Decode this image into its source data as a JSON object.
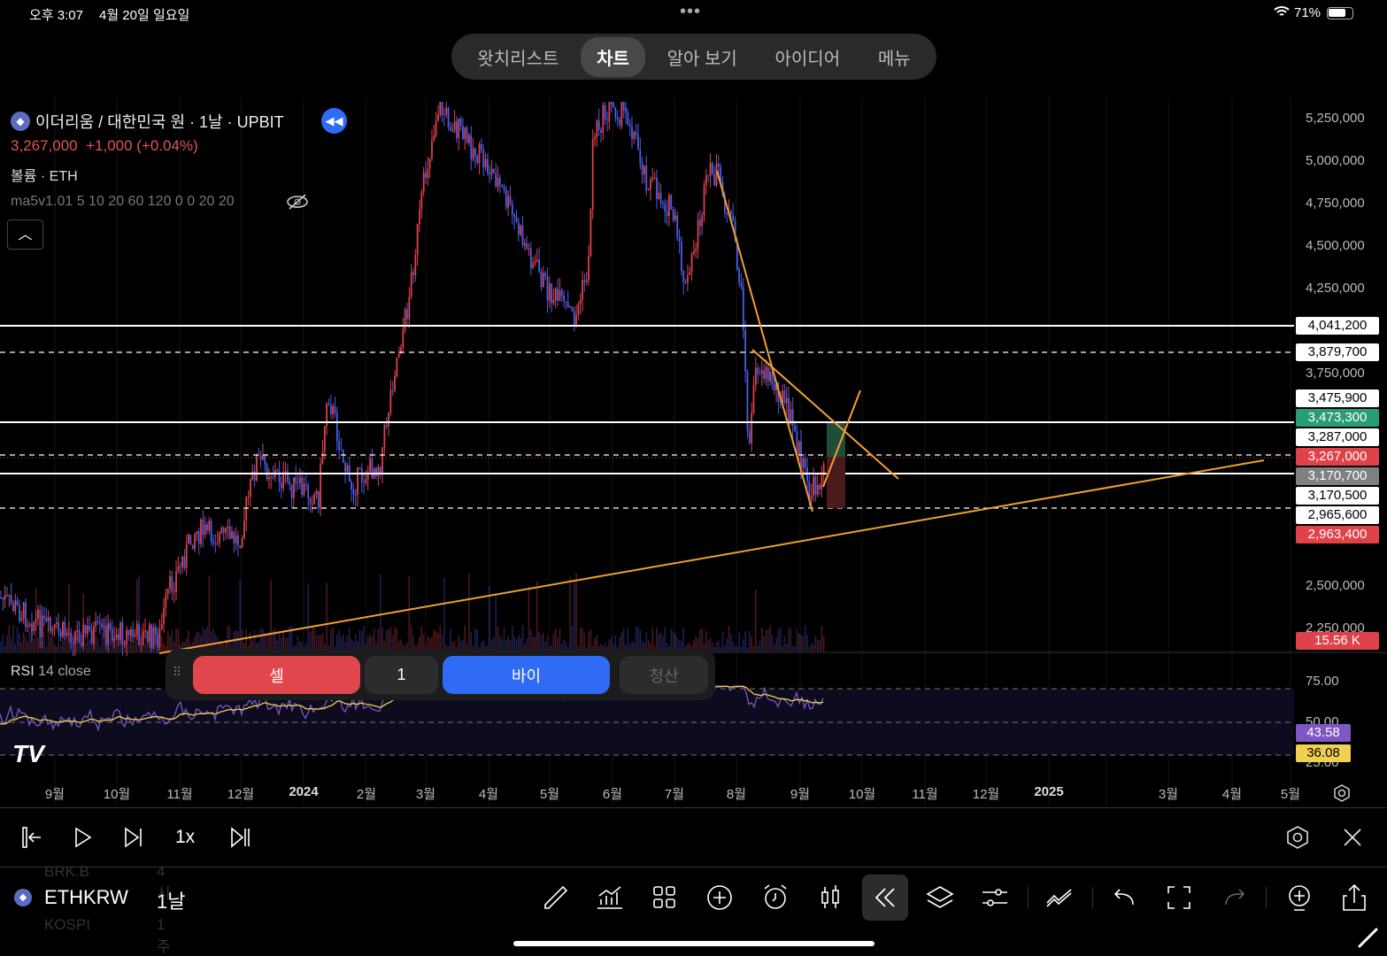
{
  "status": {
    "time": "오후 3:07",
    "date": "4월 20일 일요일",
    "battery": "71%"
  },
  "tabs": [
    {
      "label": "왓치리스트"
    },
    {
      "label": "차트",
      "active": true
    },
    {
      "label": "알아 보기"
    },
    {
      "label": "아이디어"
    },
    {
      "label": "메뉴"
    }
  ],
  "legend": {
    "title": "이더리움 / 대한민국 원 · 1날 · UPBIT",
    "price": "3,267,000",
    "change": "+1,000 (+0.04%)",
    "volume": "볼륨 · ETH",
    "ma": "ma5v1.01 5 10 20 60 120 0 0 20 20"
  },
  "price_axis": [
    "5,250,000",
    "5,000,000",
    "4,750,000",
    "4,500,000",
    "4,250,000",
    "3,750,000",
    "2,500,000",
    "2,250,000"
  ],
  "price_labels": [
    {
      "text": "4,041,200",
      "bg": "#ffffff",
      "fg": "#000"
    },
    {
      "text": "3,879,700",
      "bg": "#ffffff",
      "fg": "#000"
    },
    {
      "text": "3,475,900",
      "bg": "#ffffff",
      "fg": "#000"
    },
    {
      "text": "3,473,300",
      "bg": "#2a9d78",
      "fg": "#fff"
    },
    {
      "text": "3,287,000",
      "bg": "#ffffff",
      "fg": "#000"
    },
    {
      "text": "3,267,000",
      "bg": "#e0424a",
      "fg": "#fff"
    },
    {
      "text": "3,170,700",
      "bg": "#808080",
      "fg": "#fff"
    },
    {
      "text": "3,170,500",
      "bg": "#ffffff",
      "fg": "#000"
    },
    {
      "text": "2,965,600",
      "bg": "#ffffff",
      "fg": "#000"
    },
    {
      "text": "2,963,400",
      "bg": "#e0424a",
      "fg": "#fff"
    }
  ],
  "volume_label": "15.56 K",
  "rsi": {
    "title": "RSI",
    "params": "14 close",
    "axis": [
      "75.00",
      "50.00",
      "25.00"
    ],
    "value": "43.58",
    "ma_value": "36.08"
  },
  "trade": {
    "sell": "셀",
    "qty": "1",
    "buy": "바이",
    "close": "청산"
  },
  "time_axis": [
    "9월",
    "10월",
    "11월",
    "12월",
    "2024",
    "2월",
    "3월",
    "4월",
    "5월",
    "6월",
    "7월",
    "8월",
    "9월",
    "10월",
    "11월",
    "12월",
    "2025",
    "3월",
    "4월",
    "5월"
  ],
  "playback": {
    "speed": "1x"
  },
  "symbol": {
    "ticker": "ETHKRW",
    "interval": "1날",
    "prev_ticker": "BRK.B",
    "prev_interval": "4시",
    "next_ticker": "KOSPI",
    "next_interval": "1주"
  },
  "colors": {
    "up": "#e0424a",
    "down": "#4a5ee8",
    "trend": "#f0a030",
    "rsi": "#7e57c2",
    "rsi_ma": "#f0d050",
    "buy": "#2f6bf5",
    "sell": "#e0474d"
  }
}
